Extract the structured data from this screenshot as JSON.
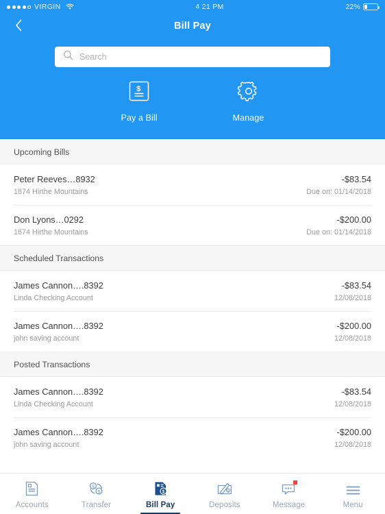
{
  "status_bar": {
    "signal_dots_filled": 4,
    "signal_dots_total": 5,
    "carrier": "VIRGIN",
    "wifi_icon": "wifi-icon",
    "time": "4 21 PM",
    "battery_percent": "22%",
    "battery_level": 22
  },
  "nav": {
    "back_icon": "chevron-left-icon",
    "title": "Bill Pay"
  },
  "search": {
    "icon": "search-icon",
    "placeholder": "Search",
    "value": ""
  },
  "actions": [
    {
      "label": "Pay a Bill",
      "icon": "invoice-dollar-icon"
    },
    {
      "label": "Manage",
      "icon": "gear-icon"
    }
  ],
  "sections": [
    {
      "title": "Upcoming Bills",
      "rows": [
        {
          "title": "Peter Reeves…8932",
          "subtitle": "1674 Hirthe Mountains",
          "amount": "-$83.54",
          "date": "Due on: 01/14/2018"
        },
        {
          "title": "Don Lyons…0292",
          "subtitle": "1674 Hirthe Mountains",
          "amount": "-$200.00",
          "date": "Due on: 01/14/2018"
        }
      ]
    },
    {
      "title": "Scheduled Transactions",
      "rows": [
        {
          "title": "James Cannon….8392",
          "subtitle": "Linda Checking Account",
          "amount": "-$83.54",
          "date": "12/08/2018"
        },
        {
          "title": "James Cannon….8392",
          "subtitle": "john saving account",
          "amount": "-$200.00",
          "date": "12/08/2018"
        }
      ]
    },
    {
      "title": "Posted Transactions",
      "rows": [
        {
          "title": "James Cannon….8392",
          "subtitle": "Linda Checking Account",
          "amount": "-$83.54",
          "date": "12/08/2018"
        },
        {
          "title": "James Cannon….8392",
          "subtitle": "john saving account",
          "amount": "-$200.00",
          "date": "12/08/2018"
        }
      ]
    }
  ],
  "tabs": [
    {
      "label": "Accounts",
      "icon": "document-account-icon",
      "active": false,
      "badge": false
    },
    {
      "label": "Transfer",
      "icon": "transfer-exchange-icon",
      "active": false,
      "badge": false
    },
    {
      "label": "Bill Pay",
      "icon": "bill-pay-icon",
      "active": true,
      "badge": false
    },
    {
      "label": "Deposits",
      "icon": "check-deposit-icon",
      "active": false,
      "badge": false
    },
    {
      "label": "Message",
      "icon": "message-bubble-icon",
      "active": false,
      "badge": true
    },
    {
      "label": "Menu",
      "icon": "hamburger-menu-icon",
      "active": false,
      "badge": false
    }
  ],
  "colors": {
    "header_blue": "#2196f3",
    "active_navy": "#1b3a63",
    "tab_inactive": "#9aa7b4",
    "badge_red": "#f4433c",
    "section_bg": "#f7f7f7"
  }
}
